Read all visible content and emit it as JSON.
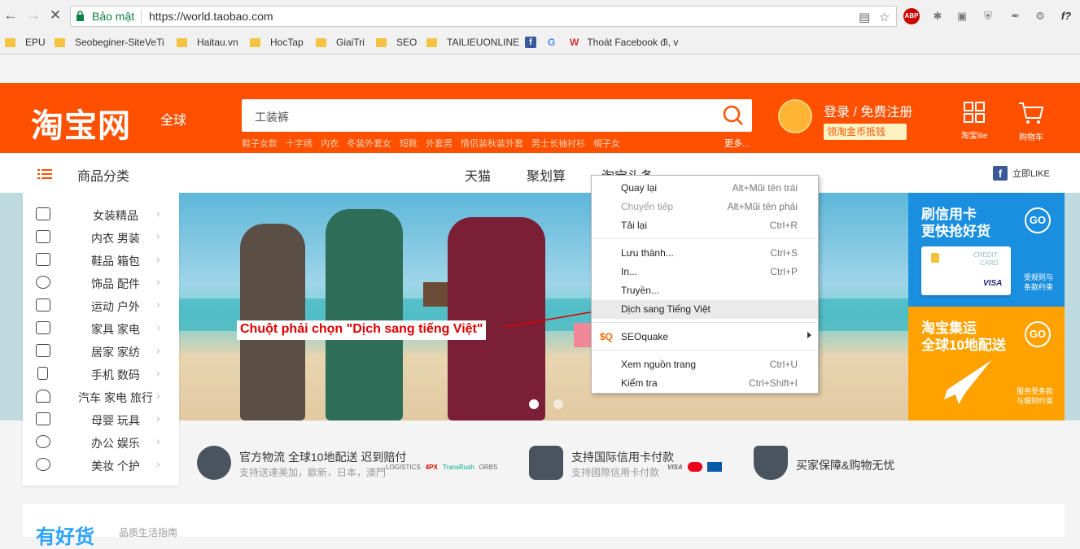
{
  "browser": {
    "secure_label": "Bảo mật",
    "url": "https://world.taobao.com",
    "bookmarks": [
      {
        "label": "EPU"
      },
      {
        "label": "Seobeginer-SiteVeTi"
      },
      {
        "label": "Haitau.vn"
      },
      {
        "label": "HocTap"
      },
      {
        "label": "GiaiTri"
      },
      {
        "label": "SEO"
      },
      {
        "label": "TAILIEUONLINE"
      },
      {
        "label": "Thoát Facebook đi, v"
      }
    ],
    "ext_abp": "ABP"
  },
  "header": {
    "logo": "淘宝网",
    "logo_sub": "全球",
    "search_value": "工装裤",
    "hot_words": [
      "鞋子女款",
      "十字绣",
      "内衣",
      "冬装外套女",
      "短靴",
      "外套男",
      "情侣装秋装外套",
      "男士长袖衬衫",
      "帽子女"
    ],
    "more": "更多...",
    "login": "登录 / 免费注册",
    "coin": "领淘金币抵钱",
    "lite": "淘宝lite",
    "cart": "购物车"
  },
  "nav": {
    "category_title": "商品分类",
    "links": [
      "天猫",
      "聚划算",
      "淘宝头条"
    ],
    "fb_like": "立即LIKE"
  },
  "categories": [
    {
      "label": "女装精品"
    },
    {
      "label": "内衣 男装"
    },
    {
      "label": "鞋品 箱包"
    },
    {
      "label": "饰品 配件"
    },
    {
      "label": "运动 户外"
    },
    {
      "label": "家具 家电"
    },
    {
      "label": "居家 家纺"
    },
    {
      "label": "手机 数码"
    },
    {
      "label": "汽车 家电 旅行"
    },
    {
      "label": "母婴 玩具"
    },
    {
      "label": "办公 娱乐"
    },
    {
      "label": "美妆 个护"
    }
  ],
  "side_cards": [
    {
      "title1": "刷信用卡",
      "title2": "更快抢好货",
      "go": "GO",
      "sub1": "受规则与",
      "sub2": "条款约束",
      "color": "#1a8fe0",
      "card_text1": "CREDIT",
      "card_text2": "CARD",
      "card_brand": "VISA"
    },
    {
      "title1": "淘宝集运",
      "title2": "全球10地配送",
      "go": "GO",
      "sub1": "服务受条款",
      "sub2": "与细则约束",
      "color": "#ffa200"
    }
  ],
  "services": [
    {
      "t1": "官方物流 全球10地配送 迟到赔付",
      "t2": "支持送達美加，歐新，日本，澳門",
      "logos": [
        "LOGISTICS",
        "4PX",
        "TransRush",
        "ORBS"
      ]
    },
    {
      "t1": "支持国际信用卡付款",
      "t2": "支持國際信用卡付款",
      "logos": [
        "VISA"
      ]
    },
    {
      "t1": "买家保障&购物无忧",
      "t2": ""
    }
  ],
  "bottom": {
    "title": "有好货",
    "subtitle": "品质生活指南"
  },
  "context_menu": {
    "items": [
      {
        "label": "Quay lại",
        "shortcut": "Alt+Mũi tên trái",
        "disabled": false
      },
      {
        "label": "Chuyển tiếp",
        "shortcut": "Alt+Mũi tên phải",
        "disabled": true
      },
      {
        "label": "Tải lại",
        "shortcut": "Ctrl+R",
        "disabled": false
      },
      {
        "label": "Lưu thành...",
        "shortcut": "Ctrl+S",
        "disabled": false
      },
      {
        "label": "In...",
        "shortcut": "Ctrl+P",
        "disabled": false
      },
      {
        "label": "Truyền...",
        "shortcut": "",
        "disabled": false
      },
      {
        "label": "Dịch sang Tiếng Việt",
        "shortcut": "",
        "disabled": false
      },
      {
        "label": "SEOquake",
        "shortcut": "",
        "disabled": false
      },
      {
        "label": "Xem nguồn trang",
        "shortcut": "Ctrl+U",
        "disabled": false
      },
      {
        "label": "Kiểm tra",
        "shortcut": "Ctrl+Shift+I",
        "disabled": false
      }
    ]
  },
  "annotation": "Chuột phải chọn \"Dịch sang tiếng Việt\"",
  "colors": {
    "accent": "#ff5000",
    "annotation": "#e00000"
  }
}
